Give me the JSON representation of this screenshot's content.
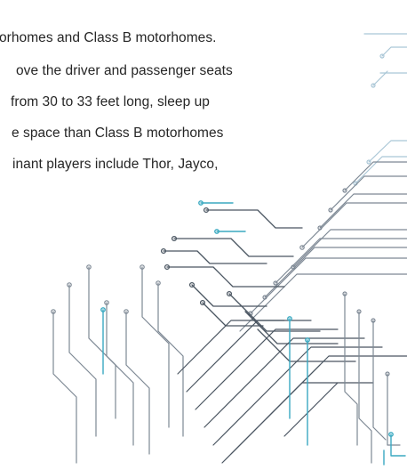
{
  "document": {
    "lines": [
      "orhomes and Class B motorhomes.",
      "ove the driver and passenger seats",
      "from 30 to 33 feet long, sleep up",
      "e space than Class B motorhomes",
      "inant players include Thor, Jayco,"
    ]
  },
  "decoration": {
    "name": "circuit-board-graphic",
    "colors": {
      "dark": "#4a5561",
      "mid": "#7d8894",
      "light": "#a9c6d6",
      "teal": "#3aa9c1"
    }
  }
}
